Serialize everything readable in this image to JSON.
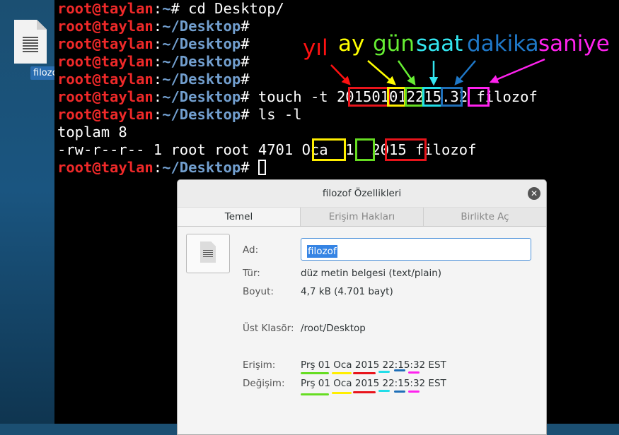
{
  "desktop": {
    "icon_label": "filozof"
  },
  "terminal": {
    "user": "root@taylan",
    "colon": ":",
    "home_path": "~",
    "desk_path": "~/Desktop",
    "prompt_char": "#",
    "lines": [
      {
        "path": "~",
        "cmd": " cd Desktop/"
      },
      {
        "path": "~/Desktop",
        "cmd": ""
      },
      {
        "path": "~/Desktop",
        "cmd": ""
      },
      {
        "path": "~/Desktop",
        "cmd": ""
      },
      {
        "path": "~/Desktop",
        "cmd": ""
      },
      {
        "path": "~/Desktop",
        "cmd": " touch -t 201501012215.32 filozof"
      },
      {
        "path": "~/Desktop",
        "cmd": " ls -l"
      }
    ],
    "output": [
      "toplam 8",
      "-rw-r--r-- 1 root root 4701 Oca  1  2015 filozof"
    ],
    "last_prompt_path": "~/Desktop"
  },
  "annotations": {
    "labels": [
      {
        "text": "yıl",
        "color": "#ff1111"
      },
      {
        "text": "ay",
        "color": "#ffff00"
      },
      {
        "text": "gün",
        "color": "#66ee33"
      },
      {
        "text": "saat",
        "color": "#33e6f0"
      },
      {
        "text": "dakika",
        "color": "#1f78c8"
      },
      {
        "text": "saniye",
        "color": "#ff22ee"
      }
    ]
  },
  "dialog": {
    "title": "filozof Özellikleri",
    "tabs": [
      "Temel",
      "Erişim Hakları",
      "Birlikte Aç"
    ],
    "active_tab": "Temel",
    "name_label": "Ad:",
    "name_value": "filozof",
    "type_label": "Tür:",
    "type_value": "düz metin belgesi (text/plain)",
    "size_label": "Boyut:",
    "size_value": "4,7 kB (4.701 bayt)",
    "folder_label": "Üst Klasör:",
    "folder_value": "/root/Desktop",
    "access_label": "Erişim:",
    "access_value": "Prş 01 Oca 2015 22:15:32 EST",
    "modified_label": "Değişim:",
    "modified_value": "Prş 01 Oca 2015 22:15:32 EST"
  },
  "colors": {
    "year": "#e8141b",
    "month": "#ffee00",
    "day": "#66dd22",
    "hour": "#22dde8",
    "minute": "#1f6fb8",
    "second": "#ff22ee"
  }
}
